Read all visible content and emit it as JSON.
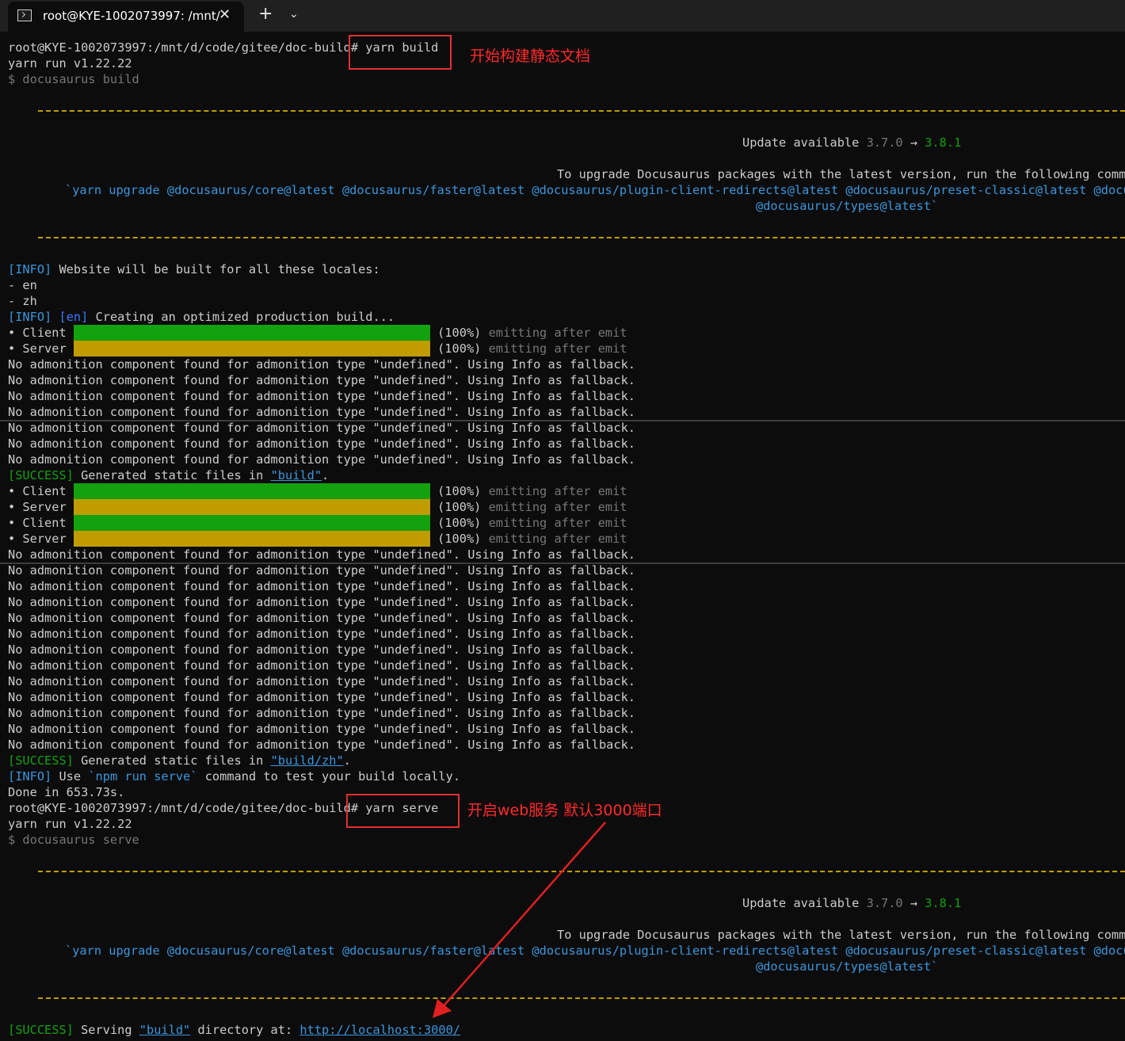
{
  "window": {
    "tab_title": "root@KYE-1002073997: /mnt/",
    "tab_close": "✕",
    "new_tab": "+",
    "dropdown": "⌄",
    "icon": "terminal-icon"
  },
  "terminal": {
    "prompt": "root@KYE-1002073997:/mnt/d/code/gitee/doc-build#",
    "cmd_build": " yarn build",
    "cmd_serve": " yarn serve",
    "yarn_version": "yarn run v1.22.22",
    "docusaurus_build": "$ docusaurus build",
    "docusaurus_serve": "$ docusaurus serve",
    "update_label": "Update available ",
    "update_from": "3.7.0",
    "update_arrow": " → ",
    "update_to": "3.8.1",
    "upgrade_text": "To upgrade Docusaurus packages with the latest version, run the following command:",
    "upgrade_cmd": "`yarn upgrade @docusaurus/core@latest @docusaurus/faster@latest @docusaurus/plugin-client-redirects@latest @docusaurus/preset-classic@latest @docusaurus/module-type-aliases@latest",
    "upgrade_cmd2": "@docusaurus/types@latest`",
    "info_tag": "[INFO]",
    "success_tag": "[SUCCESS]",
    "locales_text": " Website will be built for all these locales:",
    "locale_en": "- en",
    "locale_zh": "- zh",
    "en_tag": "[en]",
    "creating_text": " Creating an optimized production build...",
    "client_label": "• Client ",
    "server_label": "• Server ",
    "progress_pct": " (100%)",
    "progress_text": " emitting after emit",
    "progress_value": 1.0,
    "admonition_warning": "No admonition component found for admonition type \"undefined\". Using Info as fallback.",
    "generated_text": " Generated static files in ",
    "build_dir": "\"build\"",
    "build_zh_dir": "\"build/zh\"",
    "period": ".",
    "use_text": " Use ",
    "npm_serve": "`npm run serve`",
    "test_text": " command to test your build locally.",
    "done_text": "Done in 653.73s.",
    "serving_text": " Serving ",
    "directory_text": " directory at: ",
    "localhost_url": "http://localhost:3000/"
  },
  "annotations": {
    "build_note": "开始构建静态文档",
    "serve_note": "开启web服务 默认3000端口"
  },
  "colors": {
    "background": "#0c0c0c",
    "green": "#13a10e",
    "yellow": "#c19c00",
    "cyan": "#3a96dd",
    "annotation_red": "#ff2a2a"
  }
}
